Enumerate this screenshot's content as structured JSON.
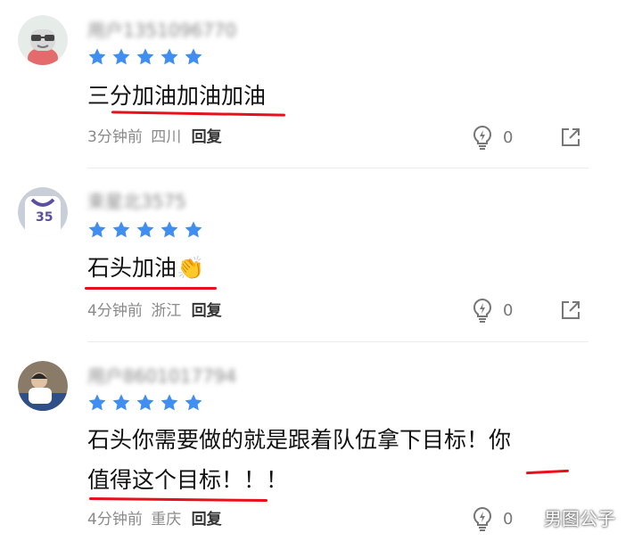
{
  "colors": {
    "star": "#3f8ef0",
    "underline": "#e8101a",
    "meta": "#8a8a8a"
  },
  "comments": [
    {
      "username": "用户1351096770",
      "rating": 5,
      "text": "三分加油加油加油",
      "time": "3分钟前",
      "location": "四川",
      "reply_label": "回复",
      "like_count": "0",
      "like_icon": "lightbulb-icon",
      "share_icon": "share-icon"
    },
    {
      "username": "束星北3575",
      "rating": 5,
      "text": "石头加油",
      "emoji": "👏",
      "time": "4分钟前",
      "location": "浙江",
      "reply_label": "回复",
      "like_count": "0",
      "like_icon": "lightbulb-icon",
      "share_icon": "share-icon"
    },
    {
      "username": "用户8601017794",
      "rating": 5,
      "text_line1": "石头你需要做的就是跟着队伍拿下目标！你",
      "text_line2": "值得这个目标！！！",
      "time": "4分钟前",
      "location": "重庆",
      "reply_label": "回复",
      "like_count": "0",
      "like_icon": "lightbulb-icon"
    }
  ],
  "watermark": "男图公子"
}
